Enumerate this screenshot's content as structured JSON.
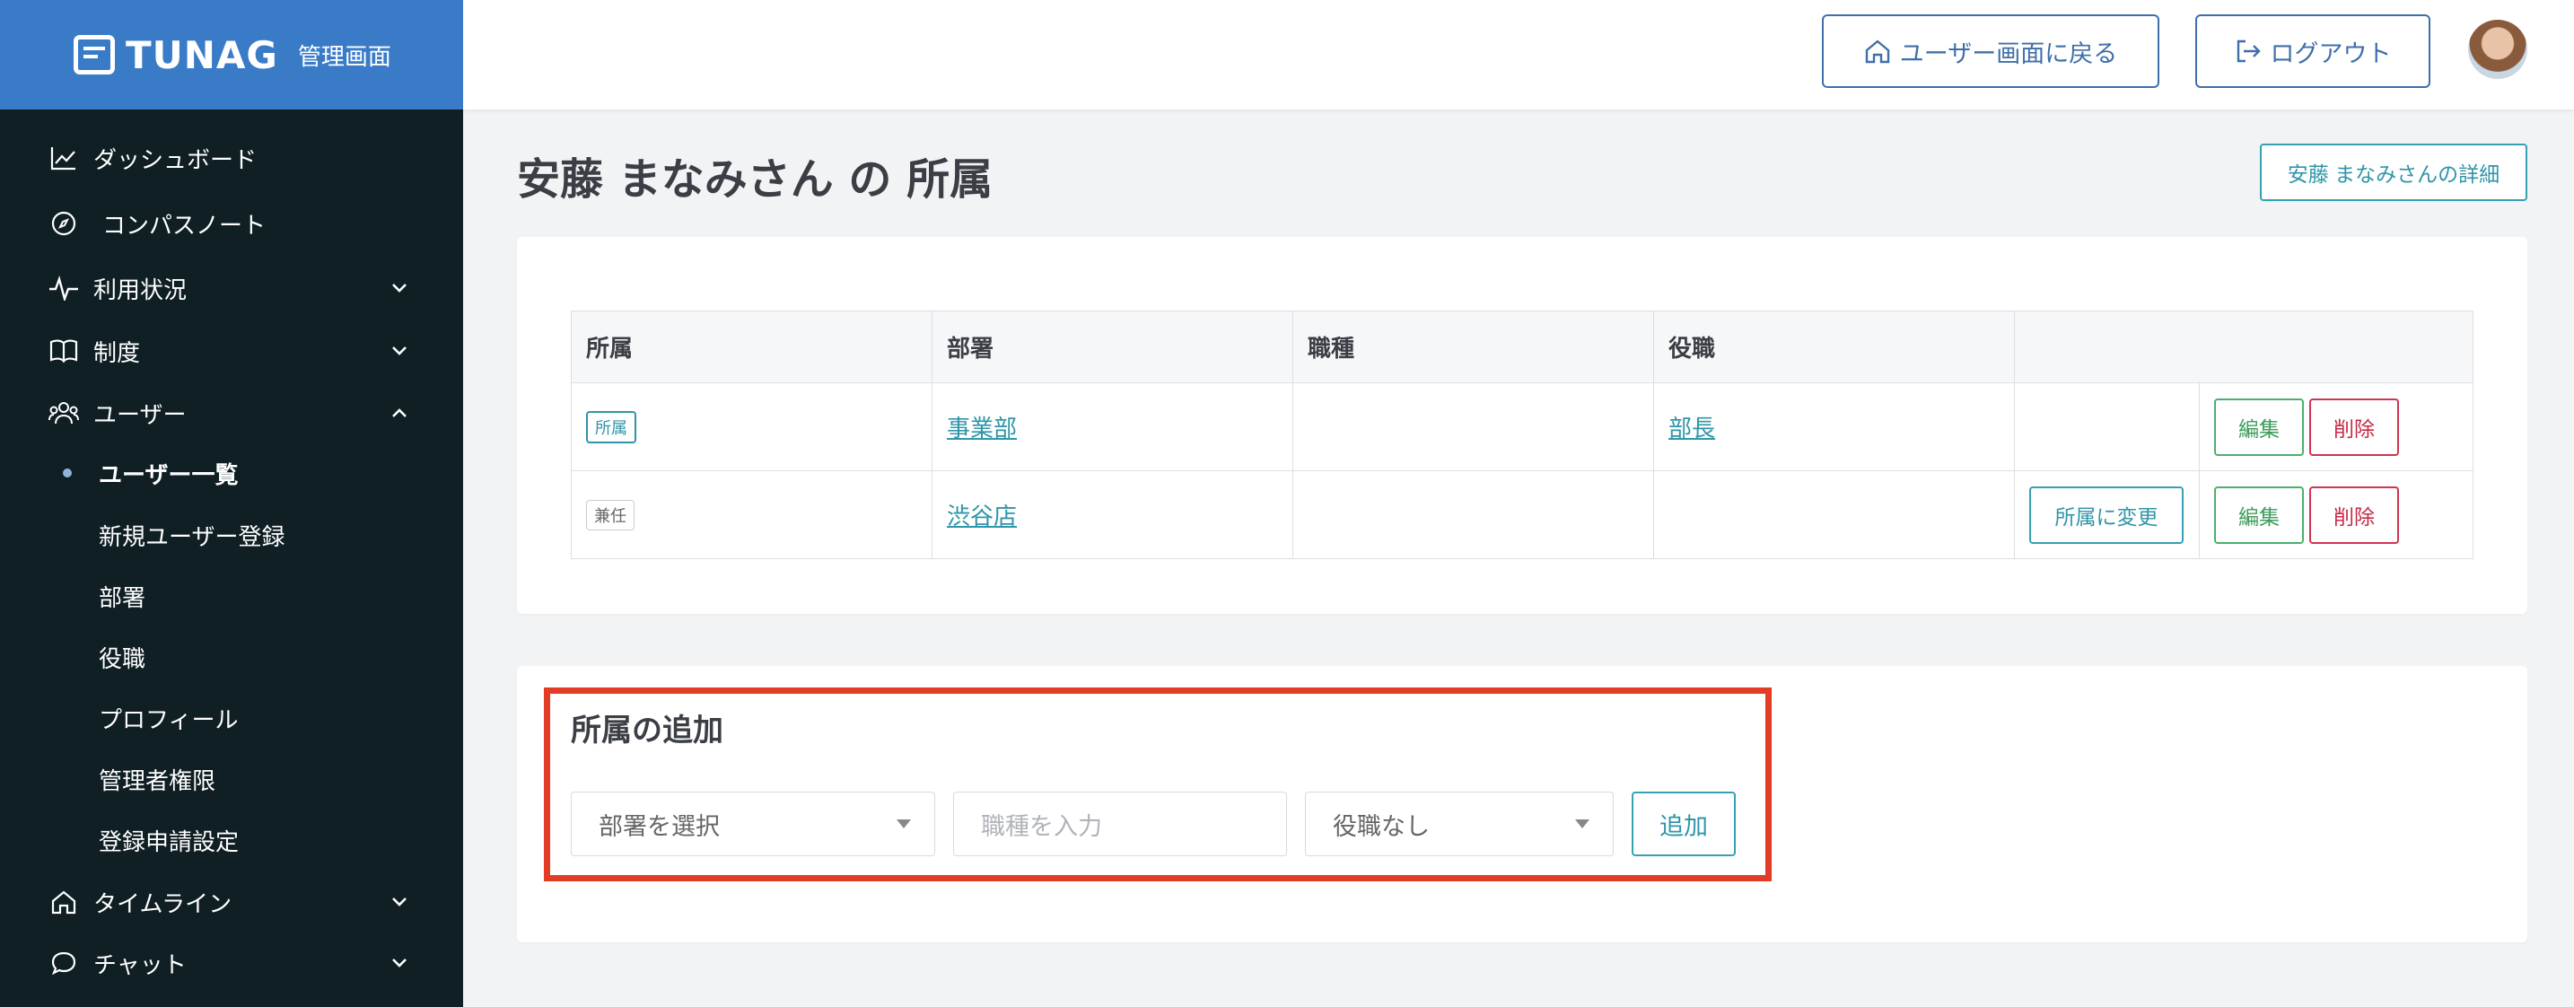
{
  "brand": {
    "name": "TUNAG",
    "sub": "管理画面"
  },
  "header": {
    "back_label": "ユーザー画面に戻る",
    "logout_label": "ログアウト"
  },
  "sidebar": {
    "items": [
      {
        "label": "ダッシュボード",
        "icon": "chart-line-icon"
      },
      {
        "label": "コンパスノート",
        "icon": "compass-icon"
      },
      {
        "label": "利用状況",
        "icon": "activity-icon"
      },
      {
        "label": "制度",
        "icon": "book-icon"
      },
      {
        "label": "ユーザー",
        "icon": "users-icon"
      },
      {
        "label": "タイムライン",
        "icon": "home-icon"
      },
      {
        "label": "チャット",
        "icon": "chat-icon"
      }
    ],
    "user_sub": [
      "ユーザー一覧",
      "新規ユーザー登録",
      "部署",
      "役職",
      "プロフィール",
      "管理者権限",
      "登録申請設定"
    ]
  },
  "main": {
    "title": "安藤 まなみさん の 所属",
    "detail_button": "安藤 まなみさんの詳細"
  },
  "table": {
    "headers": [
      "所属",
      "部署",
      "職種",
      "役職",
      ""
    ],
    "rows": [
      {
        "type": "所属",
        "dept": "事業部",
        "job": "",
        "position": "部長",
        "move": ""
      },
      {
        "type": "兼任",
        "dept": "渋谷店",
        "job": "",
        "position": "",
        "move": "所属に変更"
      }
    ],
    "edit_label": "編集",
    "delete_label": "削除"
  },
  "add_form": {
    "title": "所属の追加",
    "dept_select": "部署を選択",
    "job_placeholder": "職種を入力",
    "position_select": "役職なし",
    "add_button": "追加"
  },
  "colors": {
    "sidebar_bg": "#0f1f24",
    "brand_bg": "#3a7bc8",
    "accent": "#2f95a8",
    "highlight": "#e23b26"
  }
}
